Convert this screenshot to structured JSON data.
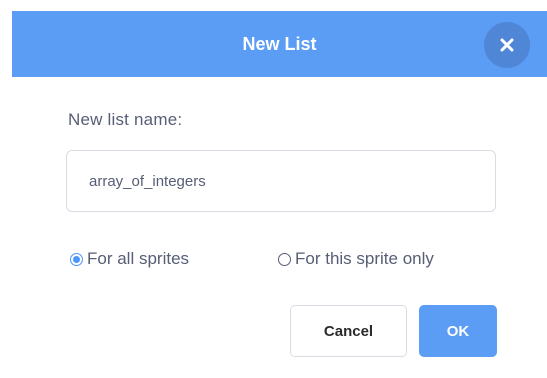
{
  "dialog": {
    "title": "New List",
    "close_icon": "close-icon",
    "field_label": "New list name:",
    "input_value": "array_of_integers",
    "scope_options": [
      {
        "label": "For all sprites",
        "checked": true
      },
      {
        "label": "For this sprite only",
        "checked": false
      }
    ],
    "cancel_label": "Cancel",
    "ok_label": "OK"
  },
  "colors": {
    "header_bg": "#5b9cf5",
    "close_bg": "#4f86d6",
    "accent": "#4c97ff",
    "text": "#575e75"
  }
}
